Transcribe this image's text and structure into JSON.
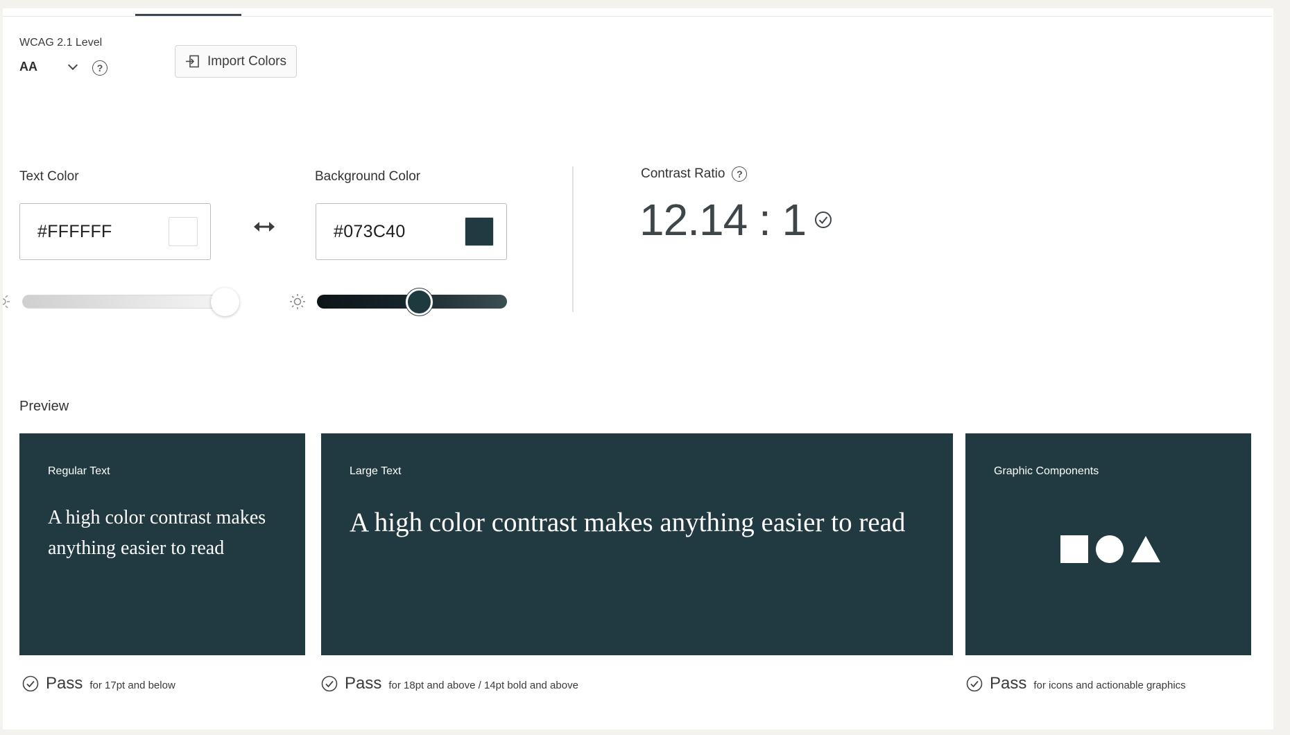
{
  "wcag": {
    "label": "WCAG 2.1 Level",
    "value": "AA",
    "help": "?"
  },
  "import_button": {
    "label": "Import Colors"
  },
  "text_color": {
    "label": "Text Color",
    "hex": "#FFFFFF",
    "swatch": "#FFFFFF",
    "slider_level": 0.97
  },
  "background_color": {
    "label": "Background Color",
    "hex": "#073C40",
    "swatch": "#213940",
    "slider_level": 0.54
  },
  "contrast": {
    "label": "Contrast Ratio",
    "value": "12.14 : 1",
    "help": "?"
  },
  "preview": {
    "label": "Preview",
    "cards": [
      {
        "title": "Regular Text",
        "sample": "A high color contrast makes anything easier to read"
      },
      {
        "title": "Large Text",
        "sample": "A high color contrast makes anything easier to read"
      },
      {
        "title": "Graphic Components"
      }
    ]
  },
  "results": [
    {
      "status": "Pass",
      "note": "for 17pt and below"
    },
    {
      "status": "Pass",
      "note": "for 18pt and above / 14pt bold and above"
    },
    {
      "status": "Pass",
      "note": "for icons and actionable graphics"
    }
  ],
  "colors": {
    "card_bg": "#213940",
    "preview_fg": "#FFFFFF",
    "accent_dark": "#3d4650"
  },
  "icons": [
    "chevron-down-icon",
    "help-icon",
    "import-icon",
    "swap-icon",
    "brightness-icon",
    "check-circle-icon",
    "square-icon",
    "circle-icon",
    "triangle-icon"
  ]
}
